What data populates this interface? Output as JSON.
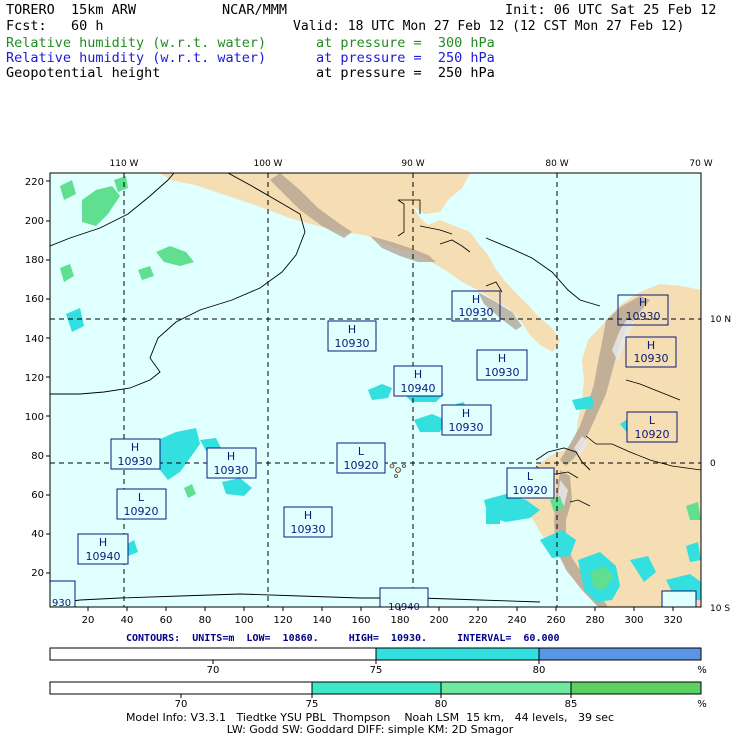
{
  "header": {
    "model": "TORERO  15km ARW",
    "center": "NCAR/MMM",
    "init": "Init: 06 UTC Sat 25 Feb 12",
    "fcst": "Fcst:   60 h",
    "valid": "Valid: 18 UTC Mon 27 Feb 12 (12 CST Mon 27 Feb 12)",
    "fields": [
      {
        "name": "Relative humidity (w.r.t. water)",
        "level": "at pressure =  300 hPa",
        "color": "#228b22"
      },
      {
        "name": "Relative humidity (w.r.t. water)",
        "level": "at pressure =  250 hPa",
        "color": "#1a1ad8"
      },
      {
        "name": "Geopotential height",
        "level": "at pressure =  250 hPa",
        "color": "#000000"
      }
    ]
  },
  "map": {
    "lon_labels": [
      "110 W",
      "100 W",
      "90 W",
      "80 W",
      "70 W"
    ],
    "lat_labels": [
      "10 N",
      "0",
      "10 S"
    ],
    "x_ticks": [
      "20",
      "40",
      "60",
      "80",
      "100",
      "120",
      "140",
      "160",
      "180",
      "200",
      "220",
      "240",
      "260",
      "280",
      "300",
      "320"
    ],
    "y_ticks": [
      "220",
      "200",
      "180",
      "160",
      "140",
      "120",
      "100",
      "80",
      "60",
      "40",
      "20"
    ],
    "colors": {
      "ocean": "#e0ffff",
      "land": "#f5deb3",
      "rh_cyan": "#33dfdf",
      "rh_green": "#5fdf8f",
      "label_border": "#0a1a7a"
    },
    "pressure_labels": [
      {
        "type": "H",
        "value": "10930"
      },
      {
        "type": "H",
        "value": "10930"
      },
      {
        "type": "H",
        "value": "10930"
      },
      {
        "type": "H",
        "value": "10930"
      },
      {
        "type": "H",
        "value": "10940"
      },
      {
        "type": "H",
        "value": "10930"
      },
      {
        "type": "H",
        "value": "10930"
      },
      {
        "type": "H",
        "value": "10930"
      },
      {
        "type": "L",
        "value": "10920"
      },
      {
        "type": "L",
        "value": "10920"
      },
      {
        "type": "L",
        "value": "10920"
      },
      {
        "type": "L",
        "value": "10920"
      },
      {
        "type": "H",
        "value": "10930"
      },
      {
        "type": "H",
        "value": "10940"
      },
      {
        "type": "H",
        "value": "10930"
      }
    ],
    "edge_labels": [
      "930",
      "10940"
    ]
  },
  "contours": {
    "units_label": "CONTOURS:  UNITS=m",
    "low": "LOW=  10860.",
    "high": "HIGH=  10930.",
    "interval": "INTERVAL=  60.000"
  },
  "colorbar1": {
    "labels": [
      "70",
      "75",
      "80"
    ],
    "unit": "%"
  },
  "colorbar2": {
    "labels": [
      "70",
      "75",
      "80",
      "85"
    ],
    "unit": "%"
  },
  "footer": {
    "line1": "Model Info: V3.3.1   Tiedtke YSU PBL  Thompson    Noah LSM  15 km,   44 levels,   39 sec",
    "line2": "LW: Godd SW: Goddard DIFF: simple KM: 2D Smagor"
  }
}
